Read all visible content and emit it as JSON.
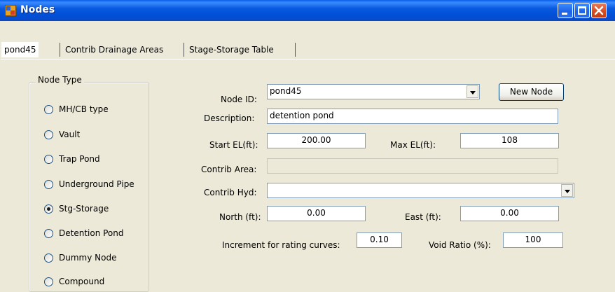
{
  "window": {
    "title": "Nodes"
  },
  "tabs": [
    {
      "label": "pond45"
    },
    {
      "label": "Contrib Drainage Areas"
    },
    {
      "label": "Stage-Storage Table"
    }
  ],
  "node_type": {
    "legend": "Node Type",
    "options": [
      {
        "label": "MH/CB type",
        "checked": false
      },
      {
        "label": "Vault",
        "checked": false
      },
      {
        "label": "Trap Pond",
        "checked": false
      },
      {
        "label": "Underground Pipe",
        "checked": false
      },
      {
        "label": "Stg-Storage",
        "checked": true
      },
      {
        "label": "Detention Pond",
        "checked": false
      },
      {
        "label": "Dummy Node",
        "checked": false
      },
      {
        "label": "Compound",
        "checked": false
      }
    ]
  },
  "form": {
    "node_id_label": "Node ID:",
    "node_id_value": "pond45",
    "new_node_label": "New Node",
    "description_label": "Description:",
    "description_value": "detention pond",
    "start_el_label": "Start EL(ft):",
    "start_el_value": "200.00",
    "max_el_label": "Max EL(ft):",
    "max_el_value": "108",
    "contrib_area_label": "Contrib Area:",
    "contrib_area_value": "",
    "contrib_hyd_label": "Contrib Hyd:",
    "contrib_hyd_value": "",
    "north_label": "North (ft):",
    "north_value": "0.00",
    "east_label": "East (ft):",
    "east_value": "0.00",
    "increment_label": "Increment for rating curves:",
    "increment_value": "0.10",
    "void_ratio_label": "Void Ratio (%):",
    "void_ratio_value": "100"
  }
}
